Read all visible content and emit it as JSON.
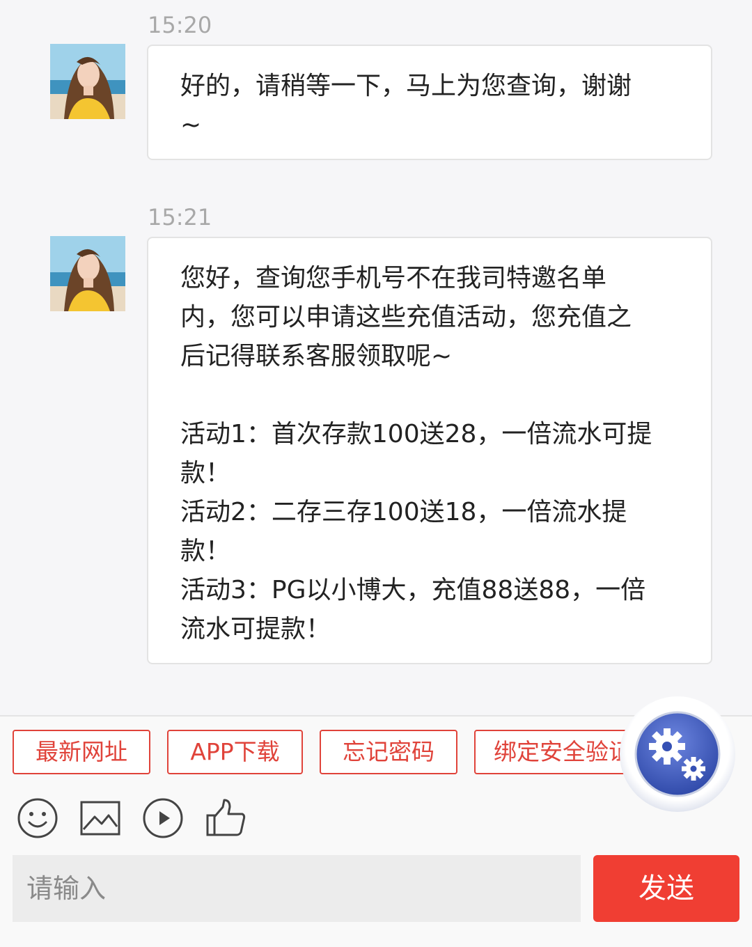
{
  "messages": [
    {
      "time": "15:20",
      "text": "好的，请稍等一下，马上为您查询，谢谢\n~"
    },
    {
      "time": "15:21",
      "text": "您好，查询您手机号不在我司特邀名单\n内，您可以申请这些充值活动，您充值之\n后记得联系客服领取呢~\n\n活动1：首次存款100送28，一倍流水可提\n款！\n活动2：二存三存100送18，一倍流水提\n款！\n活动3：PG以小博大，充值88送88，一倍\n流水可提款！"
    }
  ],
  "quick_actions": [
    "最新网址",
    "APP下载",
    "忘记密码",
    "绑定安全验证"
  ],
  "toolbar": {
    "icons": [
      "emoji-icon",
      "image-icon",
      "video-icon",
      "thumbs-up-icon"
    ]
  },
  "composer": {
    "placeholder": "请输入",
    "send_label": "发送"
  },
  "colors": {
    "accent": "#e0433a",
    "send": "#f03e33",
    "float_button": "#3a55b8"
  }
}
